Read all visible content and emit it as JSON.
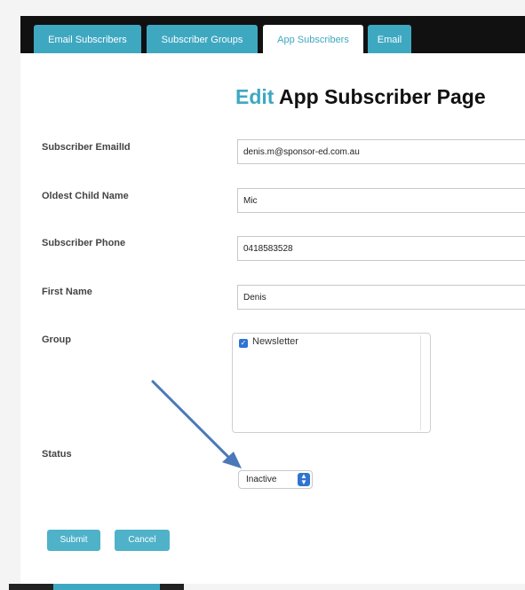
{
  "tabs": [
    {
      "label": "Email Subscribers"
    },
    {
      "label": "Subscriber Groups"
    },
    {
      "label": "App Subscribers",
      "active": true
    },
    {
      "label": "Email"
    }
  ],
  "page_title": {
    "accent": "Edit",
    "rest": " App Subscriber Page"
  },
  "form": {
    "email": {
      "label": "Subscriber EmailId",
      "value": "denis.m@sponsor-ed.com.au"
    },
    "child": {
      "label": "Oldest Child Name",
      "value": "Mic"
    },
    "phone": {
      "label": "Subscriber Phone",
      "value": "0418583528"
    },
    "first_name": {
      "label": "First Name",
      "value": "Denis"
    },
    "group": {
      "label": "Group",
      "options": [
        {
          "label": "Newsletter",
          "checked": true
        }
      ]
    },
    "status": {
      "label": "Status",
      "selected": "Inactive"
    }
  },
  "buttons": {
    "submit": "Submit",
    "cancel": "Cancel"
  },
  "colors": {
    "accent": "#3fa8c1",
    "annotation_arrow": "#4a78b8"
  }
}
